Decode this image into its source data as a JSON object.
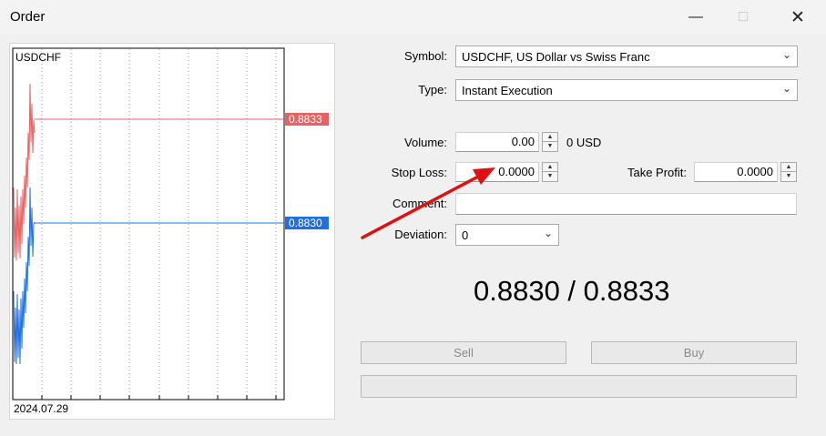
{
  "window": {
    "title": "Order"
  },
  "chart": {
    "symbol": "USDCHF",
    "ask_label": "0.8833",
    "bid_label": "0.8830",
    "date_label": "2024.07.29",
    "ask_color": "#e86060",
    "bid_color": "#1f6fe0"
  },
  "form": {
    "symbol_label": "Symbol:",
    "symbol_value": "USDCHF, US Dollar vs Swiss Franc",
    "type_label": "Type:",
    "type_value": "Instant Execution",
    "volume_label": "Volume:",
    "volume_value": "0.00",
    "volume_unit": "0 USD",
    "stop_loss_label": "Stop Loss:",
    "stop_loss_value": "0.0000",
    "take_profit_label": "Take Profit:",
    "take_profit_value": "0.0000",
    "comment_label": "Comment:",
    "comment_value": "",
    "deviation_label": "Deviation:",
    "deviation_value": "0"
  },
  "quote": {
    "text": "0.8830 / 0.8833"
  },
  "buttons": {
    "sell": "Sell",
    "buy": "Buy",
    "submit": ""
  }
}
